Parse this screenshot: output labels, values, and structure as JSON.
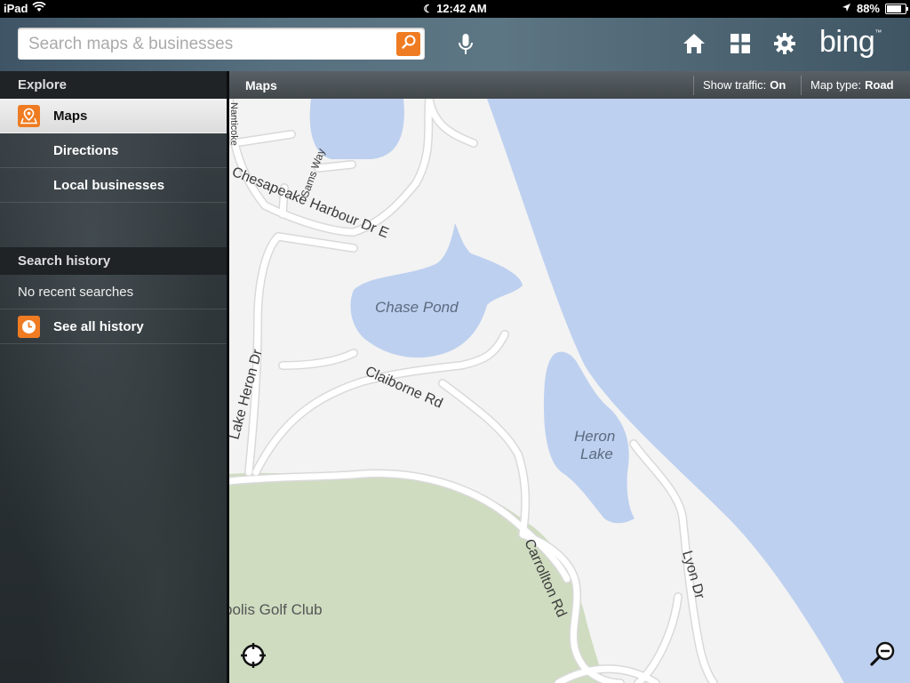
{
  "statusbar": {
    "device": "iPad",
    "time": "12:42 AM",
    "battery": "88%",
    "battery_level": 0.88
  },
  "search": {
    "placeholder": "Search maps & businesses",
    "value": ""
  },
  "topbar": {
    "icons": [
      "microphone-icon",
      "home-icon",
      "grid-icon",
      "gear-icon"
    ],
    "logo": "bing"
  },
  "sidebar": {
    "explore_header": "Explore",
    "items": [
      {
        "label": "Maps",
        "icon": "map-pin-icon",
        "selected": true
      },
      {
        "label": "Directions"
      },
      {
        "label": "Local businesses"
      }
    ],
    "history_header": "Search history",
    "no_history": "No recent searches",
    "see_all": "See all history"
  },
  "map_header": {
    "title": "Maps",
    "traffic_label": "Show traffic:",
    "traffic_value": "On",
    "maptype_label": "Map type:",
    "maptype_value": "Road"
  },
  "map": {
    "labels": {
      "top_road": "Nanticoke",
      "sams_way": "Sams Way",
      "chesapeake": "Chesapeake Harbour Dr E",
      "chase_pond": "Chase Pond",
      "claiborne": "Claiborne Rd",
      "lake_heron": "Lake Heron Dr",
      "heron_lake_1": "Heron",
      "heron_lake_2": "Lake",
      "golf_club": "polis Golf Club",
      "carrollton": "Carrollton Rd",
      "lyon": "Lyon Dr"
    },
    "colors": {
      "water": "#bdd0ef",
      "land": "#f3f3f3",
      "park": "#cfdcc0",
      "road": "#ffffff",
      "road_edge": "#d9d9d9",
      "accent": "#ef7c22"
    }
  }
}
